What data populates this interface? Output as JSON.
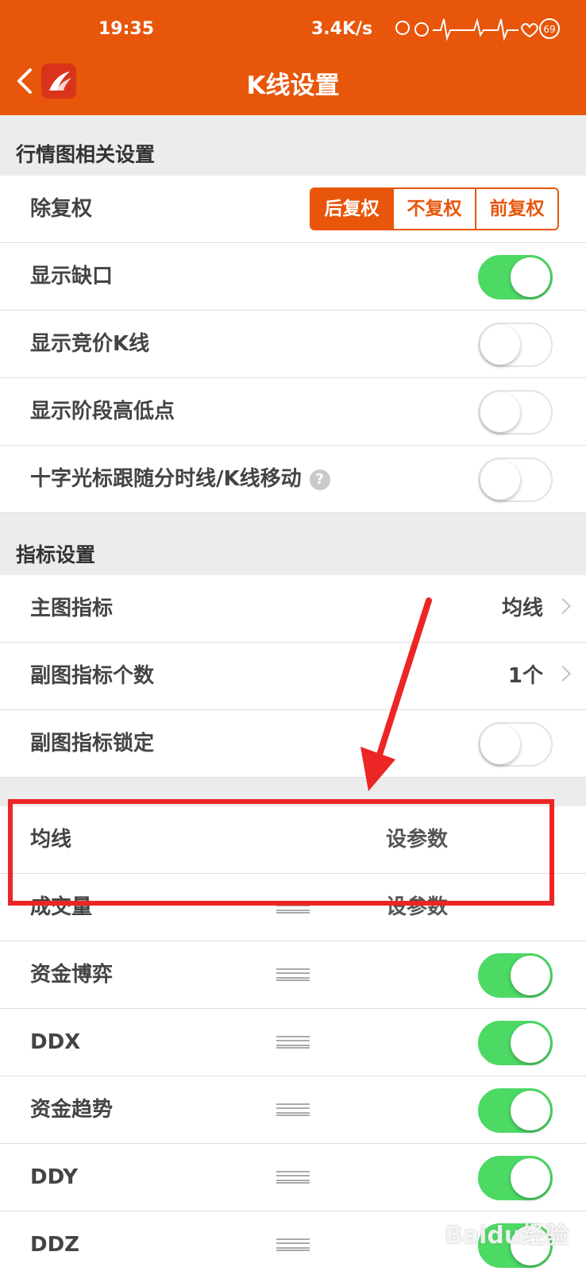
{
  "status_bar": {
    "time": "19:35",
    "network_speed": "3.4K/s",
    "battery": "69"
  },
  "header": {
    "title": "K线设置",
    "accent_color": "#e8560b"
  },
  "chart_settings": {
    "section_title": "行情图相关设置",
    "adjust_label": "除复权",
    "adjust_options": [
      "后复权",
      "不复权",
      "前复权"
    ],
    "adjust_selected": "后复权",
    "toggles": [
      {
        "label": "显示缺口",
        "on": true
      },
      {
        "label": "显示竞价K线",
        "on": false
      },
      {
        "label": "显示阶段高低点",
        "on": false
      },
      {
        "label": "十字光标跟随分时线/K线移动",
        "on": false,
        "help": "?"
      }
    ]
  },
  "indicator_settings": {
    "section_title": "指标设置",
    "main_indicator_label": "主图指标",
    "main_indicator_value": "均线",
    "sub_count_label": "副图指标个数",
    "sub_count_value": "1个",
    "sub_lock_label": "副图指标锁定",
    "sub_lock_on": false
  },
  "indicator_list": [
    {
      "name": "均线",
      "action": "设参数"
    },
    {
      "name": "成交量",
      "action": "设参数"
    },
    {
      "name": "资金博弈",
      "on": true
    },
    {
      "name": "DDX",
      "on": true
    },
    {
      "name": "资金趋势",
      "on": true
    },
    {
      "name": "DDY",
      "on": true
    },
    {
      "name": "DDZ",
      "on": true
    }
  ],
  "watermark": "Baidu经验"
}
